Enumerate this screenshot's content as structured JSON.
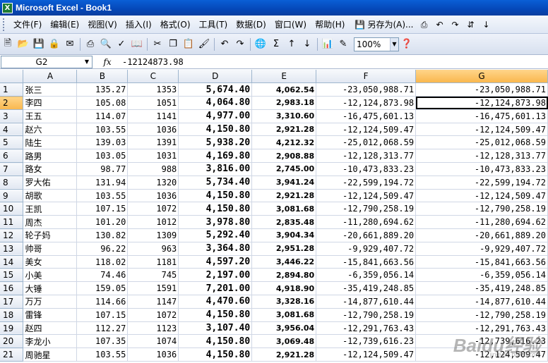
{
  "window": {
    "title": "Microsoft Excel - Book1"
  },
  "menu": {
    "items": [
      "文件(F)",
      "编辑(E)",
      "视图(V)",
      "插入(I)",
      "格式(O)",
      "工具(T)",
      "数据(D)",
      "窗口(W)",
      "帮助(H)"
    ],
    "save_as": "另存为(A)..."
  },
  "toolbar": {
    "zoom": "100%"
  },
  "formula_bar": {
    "cell_ref": "G2",
    "fx": "fx",
    "value": "-12124873.98"
  },
  "grid": {
    "columns": [
      "A",
      "B",
      "C",
      "D",
      "E",
      "F",
      "G"
    ],
    "selected_col": "G",
    "selected_row": "2",
    "rows": [
      {
        "n": "1",
        "a": "张三",
        "b": "135.27",
        "c": "1353",
        "d": "5,674.40",
        "e": "4,062.54",
        "f": "-23,050,988.71",
        "g": "-23,050,988.71"
      },
      {
        "n": "2",
        "a": "李四",
        "b": "105.08",
        "c": "1051",
        "d": "4,064.80",
        "e": "2,983.18",
        "f": "-12,124,873.98",
        "g": "-12,124,873.98"
      },
      {
        "n": "3",
        "a": "王五",
        "b": "114.07",
        "c": "1141",
        "d": "4,977.00",
        "e": "3,310.60",
        "f": "-16,475,601.13",
        "g": "-16,475,601.13"
      },
      {
        "n": "4",
        "a": "赵六",
        "b": "103.55",
        "c": "1036",
        "d": "4,150.80",
        "e": "2,921.28",
        "f": "-12,124,509.47",
        "g": "-12,124,509.47"
      },
      {
        "n": "5",
        "a": "陆生",
        "b": "139.03",
        "c": "1391",
        "d": "5,938.20",
        "e": "4,212.32",
        "f": "-25,012,068.59",
        "g": "-25,012,068.59"
      },
      {
        "n": "6",
        "a": "路男",
        "b": "103.05",
        "c": "1031",
        "d": "4,169.80",
        "e": "2,908.88",
        "f": "-12,128,313.77",
        "g": "-12,128,313.77"
      },
      {
        "n": "7",
        "a": "路女",
        "b": "98.77",
        "c": "988",
        "d": "3,816.00",
        "e": "2,745.00",
        "f": "-10,473,833.23",
        "g": "-10,473,833.23"
      },
      {
        "n": "8",
        "a": "罗大佑",
        "b": "131.94",
        "c": "1320",
        "d": "5,734.40",
        "e": "3,941.24",
        "f": "-22,599,194.72",
        "g": "-22,599,194.72"
      },
      {
        "n": "9",
        "a": "胡歌",
        "b": "103.55",
        "c": "1036",
        "d": "4,150.80",
        "e": "2,921.28",
        "f": "-12,124,509.47",
        "g": "-12,124,509.47"
      },
      {
        "n": "10",
        "a": "王凯",
        "b": "107.15",
        "c": "1072",
        "d": "4,150.80",
        "e": "3,081.68",
        "f": "-12,790,258.19",
        "g": "-12,790,258.19"
      },
      {
        "n": "11",
        "a": "周杰",
        "b": "101.20",
        "c": "1012",
        "d": "3,978.80",
        "e": "2,835.48",
        "f": "-11,280,694.62",
        "g": "-11,280,694.62"
      },
      {
        "n": "12",
        "a": "轮子妈",
        "b": "130.82",
        "c": "1309",
        "d": "5,292.40",
        "e": "3,904.34",
        "f": "-20,661,889.20",
        "g": "-20,661,889.20"
      },
      {
        "n": "13",
        "a": "帅哥",
        "b": "96.22",
        "c": "963",
        "d": "3,364.80",
        "e": "2,951.28",
        "f": "-9,929,407.72",
        "g": "-9,929,407.72"
      },
      {
        "n": "14",
        "a": "美女",
        "b": "118.02",
        "c": "1181",
        "d": "4,597.20",
        "e": "3,446.22",
        "f": "-15,841,663.56",
        "g": "-15,841,663.56"
      },
      {
        "n": "15",
        "a": "小美",
        "b": "74.46",
        "c": "745",
        "d": "2,197.00",
        "e": "2,894.80",
        "f": "-6,359,056.14",
        "g": "-6,359,056.14"
      },
      {
        "n": "16",
        "a": "大锤",
        "b": "159.05",
        "c": "1591",
        "d": "7,201.00",
        "e": "4,918.90",
        "f": "-35,419,248.85",
        "g": "-35,419,248.85"
      },
      {
        "n": "17",
        "a": "万万",
        "b": "114.66",
        "c": "1147",
        "d": "4,470.60",
        "e": "3,328.16",
        "f": "-14,877,610.44",
        "g": "-14,877,610.44"
      },
      {
        "n": "18",
        "a": "雷锋",
        "b": "107.15",
        "c": "1072",
        "d": "4,150.80",
        "e": "3,081.68",
        "f": "-12,790,258.19",
        "g": "-12,790,258.19"
      },
      {
        "n": "19",
        "a": "赵四",
        "b": "112.27",
        "c": "1123",
        "d": "3,107.40",
        "e": "3,956.04",
        "f": "-12,291,763.43",
        "g": "-12,291,763.43"
      },
      {
        "n": "20",
        "a": "李龙小",
        "b": "107.35",
        "c": "1074",
        "d": "4,150.80",
        "e": "3,069.48",
        "f": "-12,739,616.23",
        "g": "-12,739,616.23"
      },
      {
        "n": "21",
        "a": "周驰星",
        "b": "103.55",
        "c": "1036",
        "d": "4,150.80",
        "e": "2,921.28",
        "f": "-12,124,509.47",
        "g": "-12,124,509.47"
      }
    ]
  },
  "watermark": {
    "main": "Baidu经验",
    "sub": "jingyan.baidu.com"
  }
}
